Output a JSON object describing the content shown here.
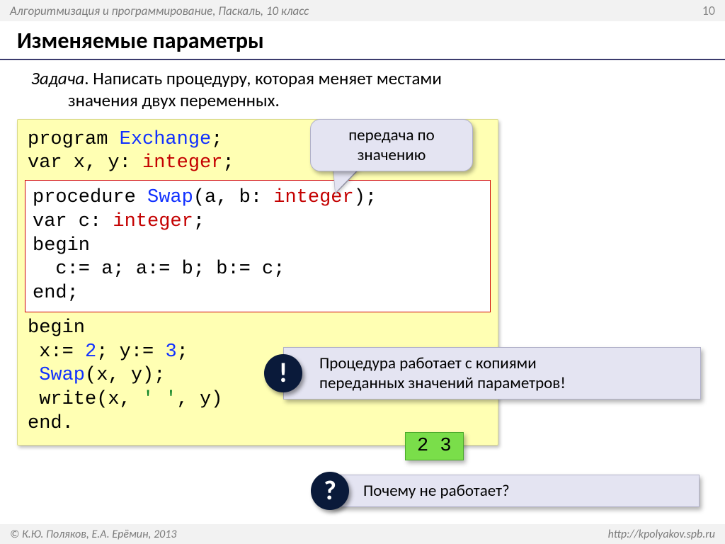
{
  "header": {
    "breadcrumb": "Алгоритмизация и программирование, Паскаль, 10 класс",
    "page_number": "10"
  },
  "title": "Изменяемые параметры",
  "task": {
    "label": "Задача",
    "text_line1": ". Написать процедуру, которая меняет местами",
    "text_line2": "значения двух переменных."
  },
  "code": {
    "l1_a": "program ",
    "l1_b": "Exchange",
    "l1_c": ";",
    "l2_a": "var x, y: ",
    "l2_b": "integer",
    "l2_c": ";",
    "inner": {
      "l1_a": "procedure ",
      "l1_b": "Swap",
      "l1_c": "(a, b: ",
      "l1_d": "integer",
      "l1_e": ");",
      "l2_a": "var c: ",
      "l2_b": "integer",
      "l2_c": ";",
      "l3": "begin",
      "l4": "  c:= a; a:= b; b:= c;",
      "l5": "end;"
    },
    "l3": "begin",
    "l4_a": " x:= ",
    "l4_b": "2",
    "l4_c": "; y:= ",
    "l4_d": "3",
    "l4_e": ";",
    "l5_a": " ",
    "l5_b": "Swap",
    "l5_c": "(x, y);",
    "l6_a": " write(x, ",
    "l6_b": "' '",
    "l6_c": ", y)",
    "l7": "end."
  },
  "callout": {
    "line1": "передача по",
    "line2": "значению"
  },
  "info1": {
    "mark": "!",
    "line1": "Процедура работает с копиями",
    "line2": "переданных значений параметров!"
  },
  "output": "2 3",
  "info2": {
    "mark": "?",
    "text": "Почему не работает?"
  },
  "footer": {
    "copyright": "© К.Ю. Поляков, Е.А. Ерёмин, 2013",
    "url": "http://kpolyakov.spb.ru"
  }
}
